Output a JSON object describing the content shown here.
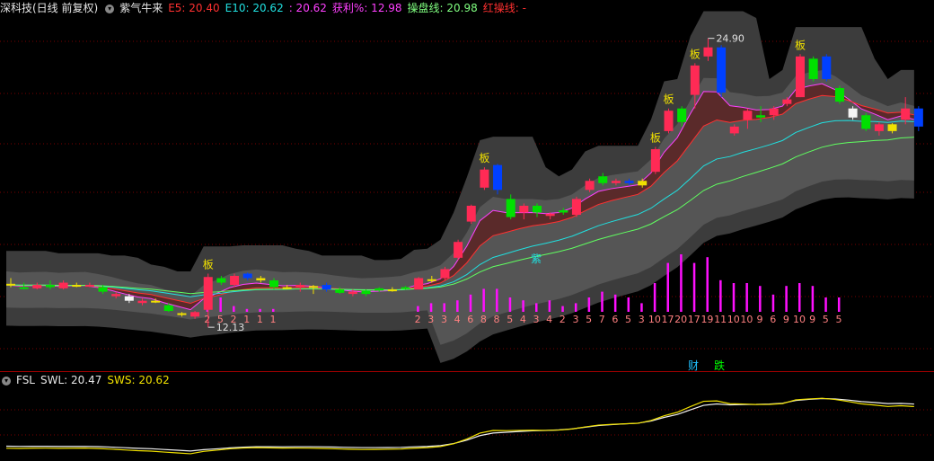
{
  "header": {
    "stock": "深科技(日线 前复权)",
    "indicator": "紫气牛来",
    "e5": "E5: 20.40",
    "e10": "E10: 20.62",
    "v3": ": 20.62",
    "profit": "获利%: 12.98",
    "trade_line": "操盘线: 20.98",
    "red_line": "红操线: -"
  },
  "sub": {
    "name": "FSL",
    "swl": "SWL: 20.47",
    "sws": "SWS: 20.62"
  },
  "colors": {
    "up": "#ff2a55",
    "down": "#00e000",
    "blue": "#0040ff",
    "magenta": "#ff00ff",
    "yellow": "#f0e000",
    "grid": "#8b0000"
  },
  "chart_data": {
    "type": "candlestick",
    "ylim": [
      11.5,
      25.8
    ],
    "high_label": "24.90",
    "low_label": "12.13",
    "candles": [
      {
        "o": 14.05,
        "c": 14.0,
        "h": 14.3,
        "l": 13.9,
        "col": "#f0e000"
      },
      {
        "o": 13.9,
        "c": 13.85,
        "h": 14.1,
        "l": 13.8,
        "col": "#00e000"
      },
      {
        "o": 13.85,
        "c": 14.0,
        "h": 14.1,
        "l": 13.8,
        "col": "#ff2a55"
      },
      {
        "o": 13.9,
        "c": 14.0,
        "h": 14.2,
        "l": 13.8,
        "col": "#00e000"
      },
      {
        "o": 14.1,
        "c": 13.85,
        "h": 14.2,
        "l": 13.8,
        "col": "#ff2a55"
      },
      {
        "o": 14.0,
        "c": 14.0,
        "h": 14.1,
        "l": 13.9,
        "col": "#f0e000"
      },
      {
        "o": 14.0,
        "c": 14.0,
        "h": 14.1,
        "l": 13.9,
        "col": "#ff2a55"
      },
      {
        "o": 13.9,
        "c": 13.7,
        "h": 14.0,
        "l": 13.6,
        "col": "#00e000"
      },
      {
        "o": 13.6,
        "c": 13.5,
        "h": 13.7,
        "l": 13.4,
        "col": "#ff2a55"
      },
      {
        "o": 13.5,
        "c": 13.3,
        "h": 13.6,
        "l": 13.2,
        "col": "#f5f5f5"
      },
      {
        "o": 13.3,
        "c": 13.2,
        "h": 13.4,
        "l": 13.1,
        "col": "#ff2a55"
      },
      {
        "o": 13.3,
        "c": 13.25,
        "h": 13.4,
        "l": 13.2,
        "col": "#f0e000"
      },
      {
        "o": 13.1,
        "c": 12.85,
        "h": 13.2,
        "l": 12.8,
        "col": "#00e000"
      },
      {
        "o": 12.7,
        "c": 12.75,
        "h": 12.8,
        "l": 12.6,
        "col": "#f0e000"
      },
      {
        "o": 12.8,
        "c": 12.6,
        "h": 12.85,
        "l": 12.5,
        "col": "#ff2a55"
      },
      {
        "o": 12.9,
        "c": 14.35,
        "h": 14.5,
        "l": 12.13,
        "col": "#ff2a55",
        "tag": "板"
      },
      {
        "o": 14.3,
        "c": 14.1,
        "h": 14.4,
        "l": 14.0,
        "col": "#00e000"
      },
      {
        "o": 14.0,
        "c": 14.4,
        "h": 14.5,
        "l": 13.9,
        "col": "#ff2a55"
      },
      {
        "o": 14.5,
        "c": 14.3,
        "h": 14.55,
        "l": 14.2,
        "col": "#0040ff"
      },
      {
        "o": 14.3,
        "c": 14.2,
        "h": 14.4,
        "l": 14.1,
        "col": "#f0e000"
      },
      {
        "o": 14.2,
        "c": 13.9,
        "h": 14.3,
        "l": 13.8,
        "col": "#00e000"
      },
      {
        "o": 13.9,
        "c": 13.85,
        "h": 14.0,
        "l": 13.8,
        "col": "#f0e000"
      },
      {
        "o": 13.9,
        "c": 14.0,
        "h": 14.1,
        "l": 13.7,
        "col": "#ff2a55"
      },
      {
        "o": 13.95,
        "c": 13.9,
        "h": 14.0,
        "l": 13.6,
        "col": "#f0e000"
      },
      {
        "o": 14.0,
        "c": 13.8,
        "h": 14.1,
        "l": 13.7,
        "col": "#0040ff"
      },
      {
        "o": 13.8,
        "c": 13.65,
        "h": 13.9,
        "l": 13.6,
        "col": "#00e000"
      },
      {
        "o": 13.7,
        "c": 13.6,
        "h": 13.8,
        "l": 13.5,
        "col": "#ff2a55"
      },
      {
        "o": 13.75,
        "c": 13.6,
        "h": 13.8,
        "l": 13.5,
        "col": "#00e000"
      },
      {
        "o": 13.85,
        "c": 13.75,
        "h": 13.9,
        "l": 13.7,
        "col": "#00e000"
      },
      {
        "o": 13.8,
        "c": 13.8,
        "h": 13.9,
        "l": 13.7,
        "col": "#f0e000"
      },
      {
        "o": 13.9,
        "c": 13.9,
        "h": 13.95,
        "l": 13.8,
        "col": "#00e000"
      },
      {
        "o": 13.8,
        "c": 14.3,
        "h": 14.35,
        "l": 13.8,
        "col": "#ff2a55"
      },
      {
        "o": 14.2,
        "c": 14.25,
        "h": 14.4,
        "l": 14.1,
        "col": "#f0e000"
      },
      {
        "o": 14.3,
        "c": 14.7,
        "h": 14.8,
        "l": 14.2,
        "col": "#ff2a55"
      },
      {
        "o": 15.2,
        "c": 15.9,
        "h": 16.0,
        "l": 15.1,
        "col": "#ff2a55"
      },
      {
        "o": 16.8,
        "c": 17.5,
        "h": 17.55,
        "l": 16.7,
        "col": "#ff2a55"
      },
      {
        "o": 18.3,
        "c": 19.1,
        "h": 19.2,
        "l": 18.2,
        "col": "#ff2a55",
        "tag": "板"
      },
      {
        "o": 19.3,
        "c": 18.2,
        "h": 19.35,
        "l": 18.0,
        "col": "#0040ff"
      },
      {
        "o": 17.8,
        "c": 17.0,
        "h": 18.0,
        "l": 16.9,
        "col": "#00e000"
      },
      {
        "o": 17.5,
        "c": 17.2,
        "h": 17.6,
        "l": 16.9,
        "col": "#ff2a55"
      },
      {
        "o": 17.5,
        "c": 17.2,
        "h": 17.6,
        "l": 17.0,
        "col": "#00e000"
      },
      {
        "o": 17.15,
        "c": 17.05,
        "h": 17.2,
        "l": 16.9,
        "col": "#ff2a55"
      },
      {
        "o": 17.2,
        "c": 17.3,
        "h": 17.4,
        "l": 17.1,
        "col": "#00e000"
      },
      {
        "o": 17.1,
        "c": 17.8,
        "h": 17.9,
        "l": 17.0,
        "col": "#ff2a55"
      },
      {
        "o": 18.2,
        "c": 18.6,
        "h": 18.7,
        "l": 18.1,
        "col": "#ff2a55"
      },
      {
        "o": 18.5,
        "c": 18.8,
        "h": 18.95,
        "l": 18.4,
        "col": "#00e000"
      },
      {
        "o": 18.6,
        "c": 18.5,
        "h": 18.7,
        "l": 18.4,
        "col": "#ff2a55"
      },
      {
        "o": 18.6,
        "c": 18.5,
        "h": 18.7,
        "l": 18.4,
        "col": "#0040ff"
      },
      {
        "o": 18.4,
        "c": 18.6,
        "h": 18.7,
        "l": 18.3,
        "col": "#f0e000"
      },
      {
        "o": 19.0,
        "c": 20.0,
        "h": 20.1,
        "l": 18.9,
        "col": "#ff2a55",
        "tag": "板"
      },
      {
        "o": 20.8,
        "c": 21.7,
        "h": 21.8,
        "l": 20.7,
        "col": "#ff2a55",
        "tag": "板"
      },
      {
        "o": 21.2,
        "c": 21.8,
        "h": 21.9,
        "l": 21.0,
        "col": "#00e000"
      },
      {
        "o": 22.4,
        "c": 23.7,
        "h": 23.8,
        "l": 21.8,
        "col": "#ff2a55",
        "tag": "板"
      },
      {
        "o": 24.1,
        "c": 24.5,
        "h": 24.9,
        "l": 23.9,
        "col": "#ff2a55"
      },
      {
        "o": 24.5,
        "c": 22.5,
        "h": 24.6,
        "l": 22.3,
        "col": "#0040ff"
      },
      {
        "o": 21.0,
        "c": 20.7,
        "h": 21.1,
        "l": 20.6,
        "col": "#ff2a55"
      },
      {
        "o": 21.3,
        "c": 21.7,
        "h": 21.8,
        "l": 20.9,
        "col": "#ff2a55"
      },
      {
        "o": 21.4,
        "c": 21.5,
        "h": 21.9,
        "l": 21.2,
        "col": "#00e000"
      },
      {
        "o": 21.5,
        "c": 21.8,
        "h": 21.9,
        "l": 21.3,
        "col": "#ff2a55"
      },
      {
        "o": 22.0,
        "c": 22.2,
        "h": 22.3,
        "l": 21.9,
        "col": "#ff2a55"
      },
      {
        "o": 22.3,
        "c": 24.1,
        "h": 24.2,
        "l": 22.3,
        "col": "#ff2a55",
        "tag": "板"
      },
      {
        "o": 24.0,
        "c": 23.1,
        "h": 24.1,
        "l": 23.0,
        "col": "#00e000"
      },
      {
        "o": 24.1,
        "c": 23.1,
        "h": 24.2,
        "l": 23.0,
        "col": "#0040ff"
      },
      {
        "o": 22.7,
        "c": 22.1,
        "h": 22.8,
        "l": 22.0,
        "col": "#00e000"
      },
      {
        "o": 21.8,
        "c": 21.4,
        "h": 21.9,
        "l": 21.3,
        "col": "#f5f5f5"
      },
      {
        "o": 21.5,
        "c": 20.9,
        "h": 21.6,
        "l": 20.8,
        "col": "#00e000"
      },
      {
        "o": 20.8,
        "c": 21.1,
        "h": 21.2,
        "l": 20.6,
        "col": "#ff2a55"
      },
      {
        "o": 21.1,
        "c": 20.8,
        "h": 21.15,
        "l": 20.7,
        "col": "#f0e000"
      },
      {
        "o": 21.3,
        "c": 21.8,
        "h": 22.3,
        "l": 21.1,
        "col": "#ff2a55"
      },
      {
        "o": 21.8,
        "c": 21.0,
        "h": 21.9,
        "l": 20.8,
        "col": "#0040ff"
      }
    ],
    "counts_label": "2521111 1 23346885434235 6 5 3 101720171911 1010 9 6 9 109 5 5",
    "markers": {
      "zi": "紫",
      "cai": "财",
      "die": "跌"
    },
    "swl_series": "white line rising from ~lowest to high near end",
    "sws_series": "yellow line"
  }
}
